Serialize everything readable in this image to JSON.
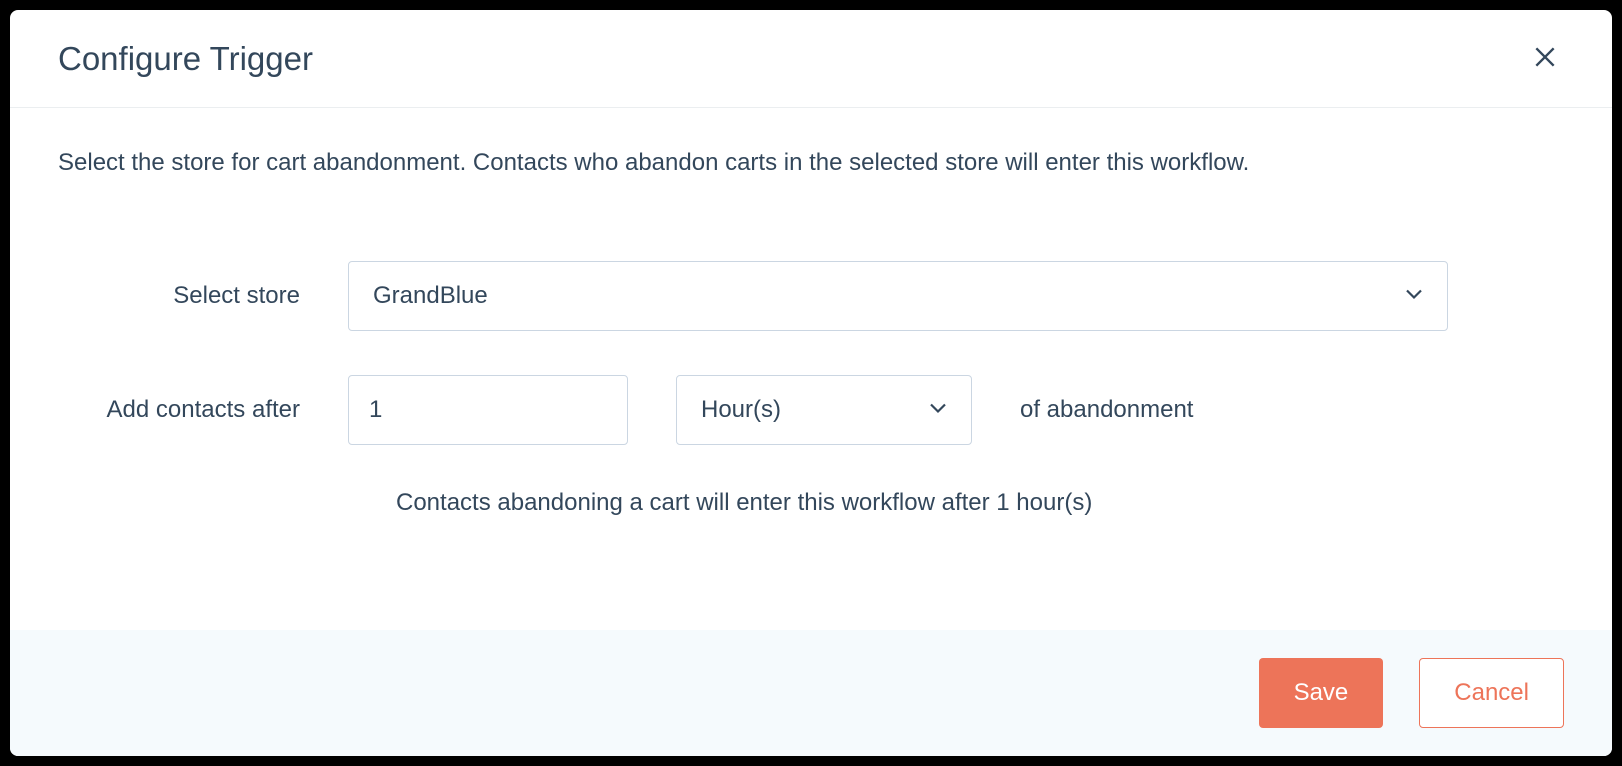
{
  "header": {
    "title": "Configure Trigger"
  },
  "body": {
    "description": "Select the store for cart abandonment. Contacts who abandon carts in the selected store will enter this workflow.",
    "store_label": "Select store",
    "store_value": "GrandBlue",
    "delay_label": "Add contacts after",
    "delay_value": "1",
    "delay_unit": "Hour(s)",
    "delay_suffix": "of abandonment",
    "helper_text": "Contacts abandoning a cart will enter this workflow after  1 hour(s)"
  },
  "footer": {
    "save_label": "Save",
    "cancel_label": "Cancel"
  }
}
